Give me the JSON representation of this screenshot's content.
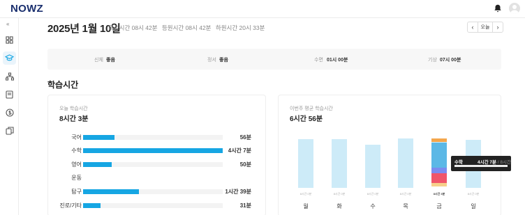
{
  "app": {
    "logo": "NOWZ"
  },
  "header": {
    "date": "2025년 1월 10일",
    "times": [
      "작성시간 08시 42분",
      "등원시간 08시 42분",
      "하원시간 20시 33분"
    ]
  },
  "date_nav": {
    "prev": "‹",
    "today": "오늘",
    "next": "›"
  },
  "status": [
    {
      "label": "신체",
      "value": "좋음"
    },
    {
      "label": "정서",
      "value": "좋음"
    },
    {
      "label": "수면",
      "value": "01시 00분"
    },
    {
      "label": "기상",
      "value": "07시 00분"
    }
  ],
  "section_title": "학습시간",
  "today_card": {
    "label": "오늘 학습시간",
    "total": "8시간 3분",
    "subjects": [
      {
        "name": "국어",
        "time": "56분",
        "fraction": 0.225
      },
      {
        "name": "수학",
        "time": "4시간 7분",
        "fraction": 1.0
      },
      {
        "name": "영어",
        "time": "50분",
        "fraction": 0.205
      },
      {
        "name": "운동",
        "time": "",
        "fraction": 0
      },
      {
        "name": "탐구",
        "time": "1시간 39분",
        "fraction": 0.4
      },
      {
        "name": "진로/기타",
        "time": "31분",
        "fraction": 0.125
      }
    ]
  },
  "weekly_card": {
    "label": "이번주 평균 학습시간",
    "average": "6시간 56분",
    "days": [
      {
        "label": "월",
        "cap": "8시간 0분",
        "fill": 0.88,
        "color": "#cdebf8"
      },
      {
        "label": "화",
        "cap": "8시간 0분",
        "fill": 0.88,
        "color": "#cdebf8"
      },
      {
        "label": "수",
        "cap": "8시간 0분",
        "fill": 0.78,
        "color": "#cdebf8"
      },
      {
        "label": "목",
        "cap": "8시간 0분",
        "fill": 0.89,
        "color": "#cdebf8"
      },
      {
        "label": "금",
        "cap": "8시간 3분",
        "fill": 0.89,
        "color": "#16a6e3",
        "selected": true
      },
      {
        "label": "일",
        "cap": "8시간 0분",
        "fill": 0.86,
        "color": "#cdebf8"
      }
    ],
    "friday_segments": [
      {
        "subject": "진로/기타",
        "color": "#f4a64c",
        "fraction": 0.07
      },
      {
        "subject": "탐구",
        "color": "#cdebf8",
        "fraction": 0.02
      },
      {
        "subject": "수학",
        "color": "#5bb8e6",
        "fraction": 0.5
      },
      {
        "subject": "영어",
        "color": "#7b8cf0",
        "fraction": 0.11
      },
      {
        "subject": "국어",
        "color": "#f0556a",
        "fraction": 0.2
      },
      {
        "subject": "기타",
        "color": "#f6d08a",
        "fraction": 0.07
      }
    ],
    "tooltip": {
      "subject": "수학",
      "time": "4시간 7분",
      "total": "/ 8시간"
    }
  },
  "colors": {
    "accent": "#16a6e3",
    "brand": "#1a2f6e"
  }
}
